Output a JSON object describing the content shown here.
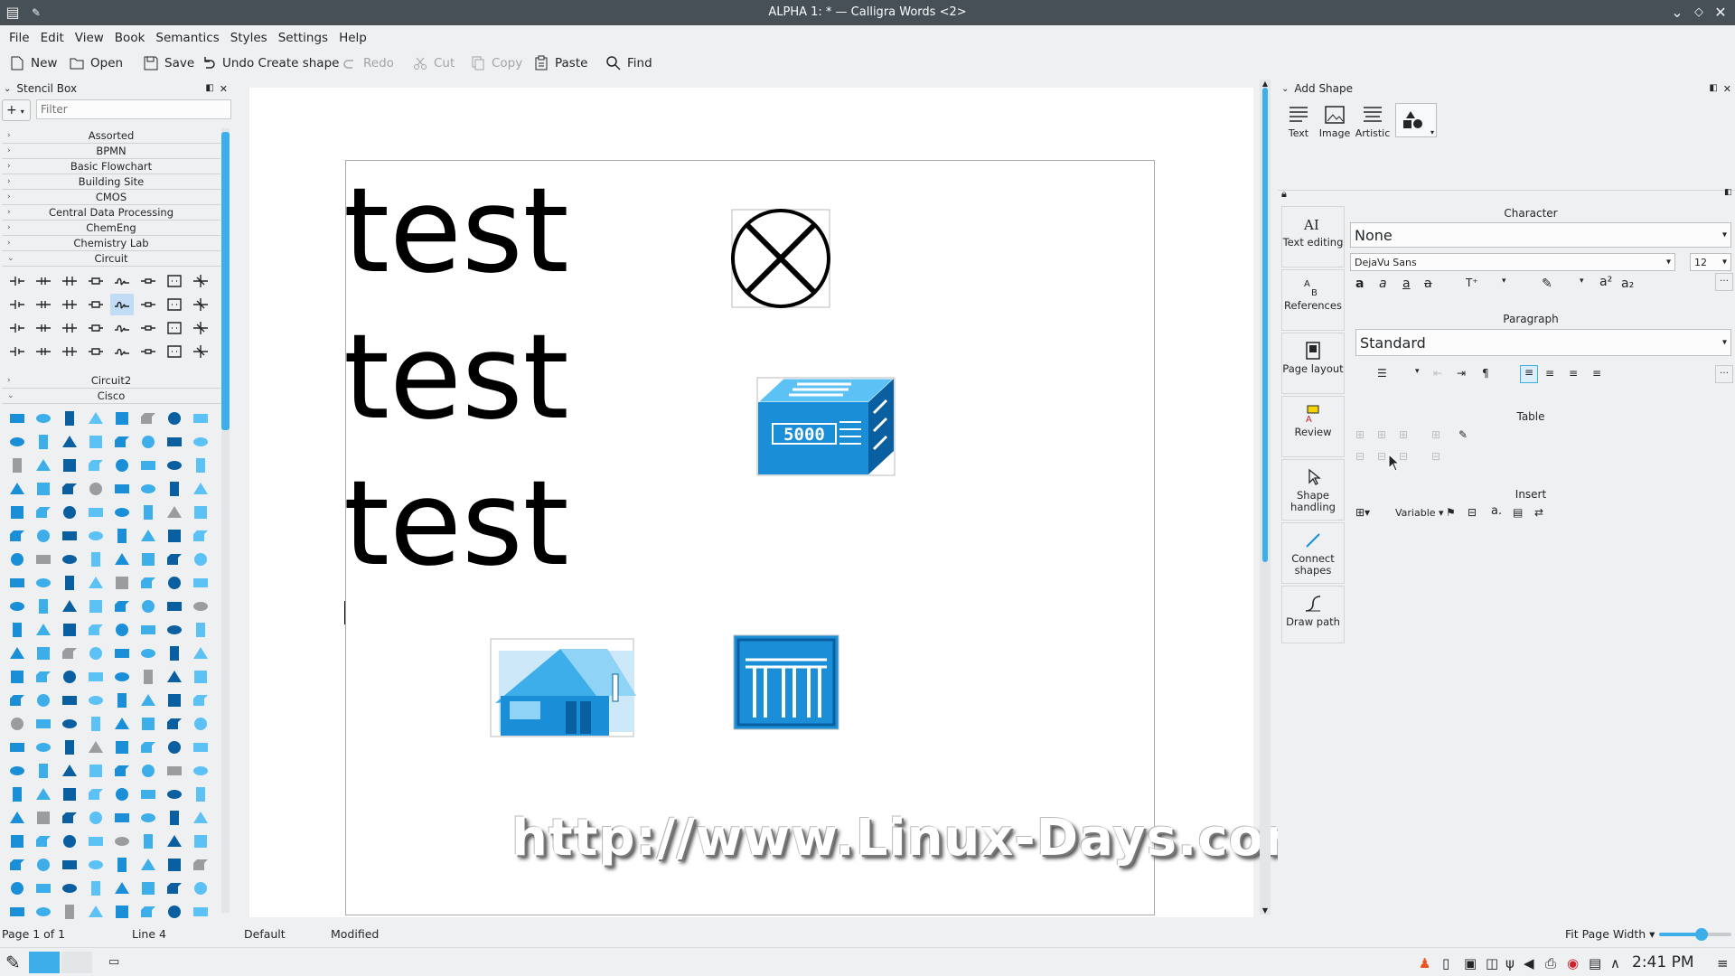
{
  "window": {
    "title": "ALPHA 1: * — Calligra Words <2>"
  },
  "menubar": {
    "items": [
      "File",
      "Edit",
      "View",
      "Book",
      "Semantics",
      "Styles",
      "Settings",
      "Help"
    ]
  },
  "toolbar": {
    "new": "New",
    "open": "Open",
    "save": "Save",
    "undo": "Undo Create shape",
    "redo": "Redo",
    "cut": "Cut",
    "copy": "Copy",
    "paste": "Paste",
    "find": "Find"
  },
  "stencil": {
    "title": "Stencil Box",
    "add_label": "+",
    "filter_placeholder": "Filter",
    "categories_top": [
      "Assorted",
      "BPMN",
      "Basic Flowchart",
      "Building Site",
      "CMOS",
      "Central Data Processing",
      "ChemEng",
      "Chemistry Lab",
      "Circuit"
    ],
    "categories_mid": [
      "Circuit2",
      "Cisco"
    ]
  },
  "document": {
    "lines": [
      "test",
      "test",
      "test"
    ],
    "watermark": "http://www.Linux-Days.com",
    "chip_label": "5000"
  },
  "add_shape": {
    "title": "Add Shape",
    "tabs": [
      "Text",
      "Image",
      "Artistic"
    ]
  },
  "tools": {
    "items": [
      "Text editing",
      "References",
      "Page layout",
      "Review",
      "Shape handling",
      "Connect shapes",
      "Draw path"
    ]
  },
  "text_options": {
    "character_label": "Character",
    "character_style": "None",
    "font_family": "DejaVu Sans",
    "font_size": "12",
    "paragraph_label": "Paragraph",
    "paragraph_style": "Standard",
    "table_label": "Table",
    "insert_label": "Insert",
    "variable_label": "Variable"
  },
  "statusbar": {
    "page": "Page 1 of 1",
    "line": "Line 4",
    "style": "Default",
    "state": "Modified",
    "zoom": "Fit Page Width"
  },
  "taskbar": {
    "clock": "2:41 PM"
  },
  "colors": {
    "accent": "#3daee9",
    "titlebar": "#475057",
    "cisco_blue": "#1a8fd8"
  }
}
